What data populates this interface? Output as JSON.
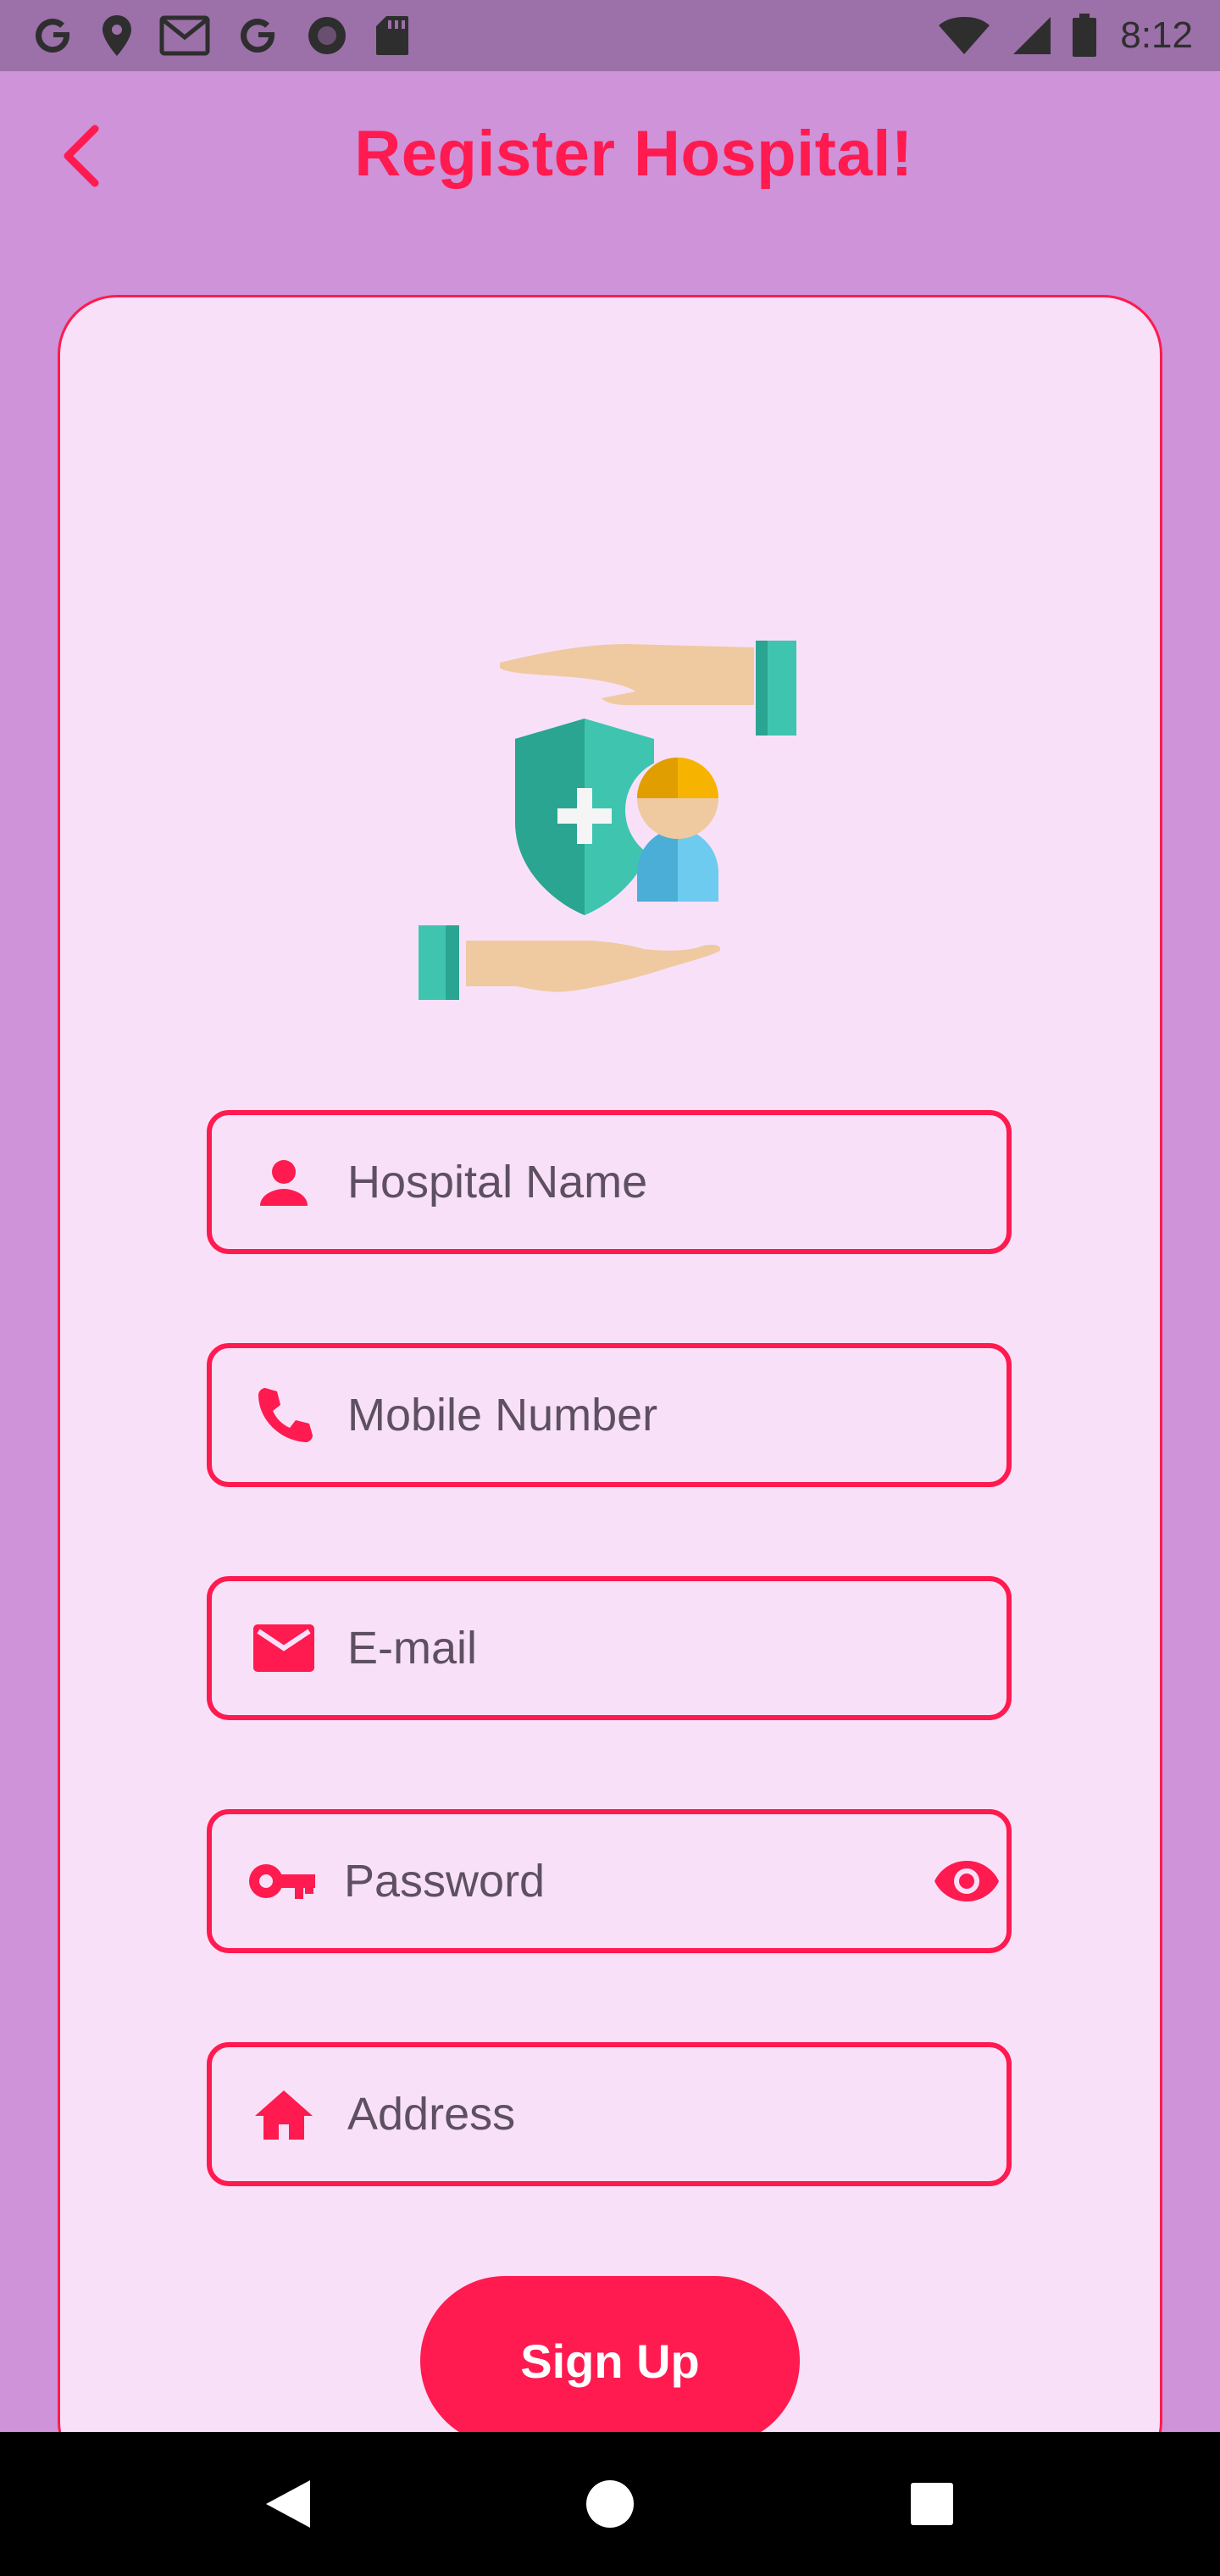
{
  "status_bar": {
    "time": "8:12",
    "left_icons": [
      "google-icon",
      "location-pin-icon",
      "gmail-icon",
      "google-icon",
      "record-icon",
      "sd-card-icon"
    ],
    "right_icons": [
      "wifi-icon",
      "signal-icon",
      "battery-icon"
    ]
  },
  "app_bar": {
    "title": "Register Hospital!",
    "back_icon": "chevron-left-icon"
  },
  "illustration": {
    "name": "hands-shield-person-illustration"
  },
  "form": {
    "hospital_name": {
      "placeholder": "Hospital Name",
      "value": "",
      "icon": "person-icon"
    },
    "mobile_number": {
      "placeholder": "Mobile Number",
      "value": "",
      "icon": "phone-icon"
    },
    "email": {
      "placeholder": "E-mail",
      "value": "",
      "icon": "mail-icon"
    },
    "password": {
      "placeholder": "Password",
      "value": "",
      "icon": "key-icon",
      "toggle_icon": "eye-icon"
    },
    "address": {
      "placeholder": "Address",
      "value": "",
      "icon": "home-icon"
    }
  },
  "signup_button": {
    "label": "Sign Up"
  },
  "nav_bar": {
    "icons": [
      "back-triangle-icon",
      "home-circle-icon",
      "recents-square-icon"
    ]
  },
  "colors": {
    "accent": "#ff1a4f",
    "background": "#ce93d8",
    "card": "#f8e1f8",
    "status_bar": "#9c70a8"
  }
}
